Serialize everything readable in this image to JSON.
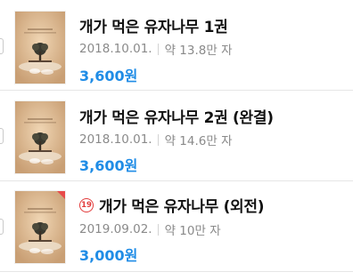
{
  "books": [
    {
      "title": "개가 먹은 유자나무 1권",
      "date": "2018.10.01.",
      "length": "약 13.8만 자",
      "price": "3,600원",
      "age_badge": null
    },
    {
      "title": "개가 먹은 유자나무 2권 (완결)",
      "date": "2018.10.01.",
      "length": "약 14.6만 자",
      "price": "3,600원",
      "age_badge": null
    },
    {
      "title": "개가 먹은 유자나무 (외전)",
      "date": "2019.09.02.",
      "length": "약 10만 자",
      "price": "3,000원",
      "age_badge": "19"
    }
  ],
  "colors": {
    "price": "#1f8ce6",
    "age_badge": "#e23b3b",
    "cover_bg": "#d9b894",
    "meta_text": "#8a8a8a"
  },
  "icons": {
    "cover": "book-cover-image",
    "age_badge": "age-19-icon"
  }
}
